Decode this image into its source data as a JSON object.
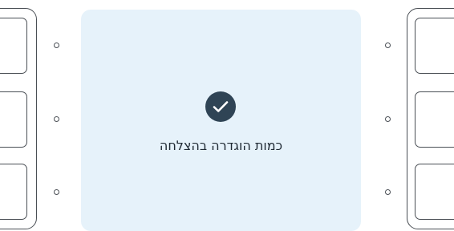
{
  "success_panel": {
    "message": "כמות הוגדרה בהצלחה",
    "icon": "check-circle-icon",
    "background_color": "#e6f2fa",
    "icon_color": "#2f4455"
  },
  "left_options": [
    {
      "selected": false
    },
    {
      "selected": false
    },
    {
      "selected": false
    }
  ],
  "right_options": [
    {
      "selected": false
    },
    {
      "selected": false
    },
    {
      "selected": false
    }
  ]
}
